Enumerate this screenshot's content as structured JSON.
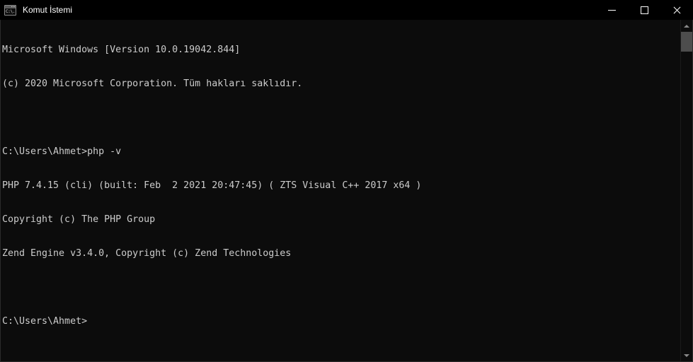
{
  "window": {
    "title": "Komut İstemi",
    "icon": "console-window-icon",
    "icon_text": "C:\\.",
    "background_color": "#0c0c0c",
    "titlebar_color": "#000000",
    "text_color": "#cccccc",
    "controls": {
      "minimize": "minimize-icon",
      "maximize": "maximize-icon",
      "close": "close-icon"
    }
  },
  "console": {
    "lines": [
      "Microsoft Windows [Version 10.0.19042.844]",
      "(c) 2020 Microsoft Corporation. Tüm hakları saklıdır.",
      "",
      "C:\\Users\\Ahmet>php -v",
      "PHP 7.4.15 (cli) (built: Feb  2 2021 20:47:45) ( ZTS Visual C++ 2017 x64 )",
      "Copyright (c) The PHP Group",
      "Zend Engine v3.4.0, Copyright (c) Zend Technologies",
      "",
      "C:\\Users\\Ahmet>"
    ]
  },
  "scrollbar": {
    "up_arrow": "scroll-up-arrow-icon",
    "down_arrow": "scroll-down-arrow-icon",
    "thumb_color": "#4d4d4d"
  }
}
